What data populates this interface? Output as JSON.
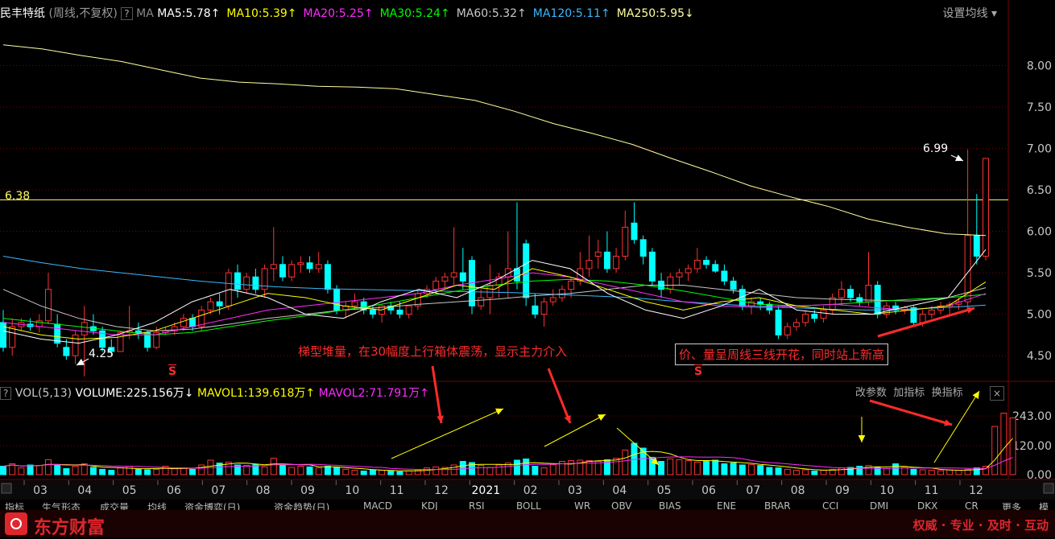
{
  "header": {
    "stock_name": "民丰特纸",
    "period": "(周线,不复权)",
    "help": "?",
    "ma_label": "MA",
    "ma_items": [
      {
        "text": "MA5:5.78",
        "arrow": "↑",
        "color": "#ffffff"
      },
      {
        "text": "MA10:5.39",
        "arrow": "↑",
        "color": "#ffff00"
      },
      {
        "text": "MA20:5.25",
        "arrow": "↑",
        "color": "#ff2bff"
      },
      {
        "text": "MA30:5.24",
        "arrow": "↑",
        "color": "#00ff00"
      },
      {
        "text": "MA60:5.32",
        "arrow": "↑",
        "color": "#c8c8c8"
      },
      {
        "text": "MA120:5.11",
        "arrow": "↑",
        "color": "#3ab8ff"
      },
      {
        "text": "MA250:5.95",
        "arrow": "↓",
        "color": "#ffffa0"
      }
    ],
    "settings": "设置均线"
  },
  "vol_header": {
    "name": "VOL(5,13)",
    "volume": "VOLUME:225.156万",
    "volume_arrow": "↓",
    "mavol1": "MAVOL1:139.618万",
    "mavol1_arrow": "↑",
    "mavol2": "MAVOL2:71.791万",
    "mavol2_arrow": "↑",
    "actions": [
      "改参数",
      "加指标",
      "换指标"
    ],
    "close": "×"
  },
  "annotations": {
    "price_line_label": "6.38",
    "high_label": "6.99",
    "low_label": "4.25",
    "text1": "梯型堆量，在30幅度上行箱体震荡，显示主力介入",
    "text2": "价、量呈周线三线开花，同时站上新高",
    "signal": "S"
  },
  "indicator_tabs": [
    "指标",
    "生气形态",
    "成交量",
    "均线",
    "资金博弈(日)",
    "资金趋势(日)",
    "MACD",
    "KDJ",
    "RSI",
    "BOLL",
    "WR",
    "OBV",
    "BIAS",
    "ENE",
    "BRAR",
    "CCI",
    "DMI",
    "DKX",
    "CR",
    "更多",
    "模板"
  ],
  "footer": {
    "brand": "东方财富",
    "slogan": "权威 · 专业 · 及时 · 互动"
  },
  "colors": {
    "up": "#ff3232",
    "down": "#00ffff",
    "grid": "#7a0000",
    "axis_text": "#c8c8c8"
  },
  "chart_data": {
    "type": "candlestick",
    "price_axis": {
      "ticks": [
        4.5,
        5.0,
        5.5,
        6.0,
        6.5,
        7.0,
        7.5,
        8.0
      ],
      "range": [
        4.2,
        8.5
      ]
    },
    "volume_axis": {
      "ticks": [
        "0.00",
        "120.00",
        "243.00"
      ],
      "range": [
        0,
        300
      ]
    },
    "x_labels": [
      "03",
      "04",
      "05",
      "06",
      "07",
      "08",
      "09",
      "10",
      "11",
      "12",
      "2021",
      "02",
      "03",
      "04",
      "05",
      "06",
      "07",
      "08",
      "09",
      "10",
      "11",
      "12"
    ],
    "horizontal_line": 6.38,
    "candles": [
      {
        "o": 4.9,
        "h": 5.05,
        "l": 4.55,
        "c": 4.6
      },
      {
        "o": 4.6,
        "h": 4.95,
        "l": 4.5,
        "c": 4.85
      },
      {
        "o": 4.85,
        "h": 4.95,
        "l": 4.8,
        "c": 4.9
      },
      {
        "o": 4.88,
        "h": 4.95,
        "l": 4.8,
        "c": 4.85
      },
      {
        "o": 4.85,
        "h": 5.0,
        "l": 4.78,
        "c": 4.92
      },
      {
        "o": 4.92,
        "h": 5.5,
        "l": 4.88,
        "c": 5.3
      },
      {
        "o": 4.88,
        "h": 5.0,
        "l": 4.6,
        "c": 4.65
      },
      {
        "o": 4.6,
        "h": 4.7,
        "l": 4.45,
        "c": 4.5
      },
      {
        "o": 4.5,
        "h": 4.8,
        "l": 4.4,
        "c": 4.75
      },
      {
        "o": 4.75,
        "h": 5.1,
        "l": 4.25,
        "c": 4.9
      },
      {
        "o": 4.85,
        "h": 5.0,
        "l": 4.75,
        "c": 4.8
      },
      {
        "o": 4.8,
        "h": 4.85,
        "l": 4.55,
        "c": 4.6
      },
      {
        "o": 4.6,
        "h": 4.7,
        "l": 4.5,
        "c": 4.55
      },
      {
        "o": 4.55,
        "h": 4.8,
        "l": 4.55,
        "c": 4.78
      },
      {
        "o": 4.78,
        "h": 5.1,
        "l": 4.7,
        "c": 4.8
      },
      {
        "o": 4.8,
        "h": 4.9,
        "l": 4.7,
        "c": 4.78
      },
      {
        "o": 4.78,
        "h": 4.8,
        "l": 4.55,
        "c": 4.6
      },
      {
        "o": 4.6,
        "h": 4.85,
        "l": 4.58,
        "c": 4.78
      },
      {
        "o": 4.78,
        "h": 4.85,
        "l": 4.75,
        "c": 4.8
      },
      {
        "o": 4.8,
        "h": 4.9,
        "l": 4.75,
        "c": 4.85
      },
      {
        "o": 4.85,
        "h": 5.0,
        "l": 4.8,
        "c": 4.95
      },
      {
        "o": 4.95,
        "h": 5.0,
        "l": 4.8,
        "c": 4.85
      },
      {
        "o": 4.85,
        "h": 5.1,
        "l": 4.8,
        "c": 5.05
      },
      {
        "o": 5.05,
        "h": 5.2,
        "l": 5.0,
        "c": 5.15
      },
      {
        "o": 5.15,
        "h": 5.25,
        "l": 5.0,
        "c": 5.1
      },
      {
        "o": 5.1,
        "h": 5.55,
        "l": 5.05,
        "c": 5.5
      },
      {
        "o": 5.5,
        "h": 5.6,
        "l": 5.2,
        "c": 5.3
      },
      {
        "o": 5.3,
        "h": 5.5,
        "l": 5.25,
        "c": 5.45
      },
      {
        "o": 5.45,
        "h": 5.55,
        "l": 5.25,
        "c": 5.3
      },
      {
        "o": 5.3,
        "h": 5.6,
        "l": 5.2,
        "c": 5.55
      },
      {
        "o": 5.55,
        "h": 6.05,
        "l": 5.4,
        "c": 5.6
      },
      {
        "o": 5.6,
        "h": 5.7,
        "l": 5.4,
        "c": 5.45
      },
      {
        "o": 5.45,
        "h": 5.65,
        "l": 5.4,
        "c": 5.6
      },
      {
        "o": 5.6,
        "h": 5.7,
        "l": 5.5,
        "c": 5.62
      },
      {
        "o": 5.62,
        "h": 5.7,
        "l": 5.5,
        "c": 5.55
      },
      {
        "o": 5.55,
        "h": 5.75,
        "l": 5.5,
        "c": 5.6
      },
      {
        "o": 5.6,
        "h": 5.65,
        "l": 5.25,
        "c": 5.3
      },
      {
        "o": 5.3,
        "h": 5.35,
        "l": 5.0,
        "c": 5.05
      },
      {
        "o": 5.05,
        "h": 5.15,
        "l": 4.95,
        "c": 5.1
      },
      {
        "o": 5.1,
        "h": 5.25,
        "l": 5.05,
        "c": 5.15
      },
      {
        "o": 5.15,
        "h": 5.2,
        "l": 5.0,
        "c": 5.05
      },
      {
        "o": 5.05,
        "h": 5.1,
        "l": 4.95,
        "c": 5.0
      },
      {
        "o": 5.0,
        "h": 5.12,
        "l": 4.9,
        "c": 5.1
      },
      {
        "o": 5.1,
        "h": 5.15,
        "l": 5.0,
        "c": 5.05
      },
      {
        "o": 5.05,
        "h": 5.15,
        "l": 4.95,
        "c": 5.0
      },
      {
        "o": 5.0,
        "h": 5.1,
        "l": 4.95,
        "c": 5.1
      },
      {
        "o": 5.1,
        "h": 5.3,
        "l": 5.05,
        "c": 5.25
      },
      {
        "o": 5.25,
        "h": 5.35,
        "l": 5.2,
        "c": 5.3
      },
      {
        "o": 5.3,
        "h": 5.45,
        "l": 5.25,
        "c": 5.4
      },
      {
        "o": 5.4,
        "h": 5.5,
        "l": 5.3,
        "c": 5.45
      },
      {
        "o": 5.45,
        "h": 6.05,
        "l": 5.35,
        "c": 5.5
      },
      {
        "o": 5.5,
        "h": 5.8,
        "l": 5.3,
        "c": 5.4
      },
      {
        "o": 5.65,
        "h": 5.7,
        "l": 5.0,
        "c": 5.1
      },
      {
        "o": 5.1,
        "h": 5.3,
        "l": 5.05,
        "c": 5.2
      },
      {
        "o": 5.2,
        "h": 5.6,
        "l": 5.0,
        "c": 5.35
      },
      {
        "o": 5.35,
        "h": 5.5,
        "l": 5.2,
        "c": 5.45
      },
      {
        "o": 5.45,
        "h": 6.0,
        "l": 5.2,
        "c": 5.55
      },
      {
        "o": 5.55,
        "h": 6.35,
        "l": 5.3,
        "c": 5.4
      },
      {
        "o": 5.85,
        "h": 5.9,
        "l": 5.1,
        "c": 5.2
      },
      {
        "o": 5.1,
        "h": 5.25,
        "l": 4.95,
        "c": 5.0
      },
      {
        "o": 5.0,
        "h": 5.2,
        "l": 4.85,
        "c": 5.15
      },
      {
        "o": 5.15,
        "h": 5.3,
        "l": 5.1,
        "c": 5.2
      },
      {
        "o": 5.2,
        "h": 5.35,
        "l": 5.15,
        "c": 5.3
      },
      {
        "o": 5.3,
        "h": 5.45,
        "l": 5.2,
        "c": 5.4
      },
      {
        "o": 5.4,
        "h": 5.75,
        "l": 5.35,
        "c": 5.55
      },
      {
        "o": 5.55,
        "h": 5.95,
        "l": 5.45,
        "c": 5.65
      },
      {
        "o": 5.7,
        "h": 5.9,
        "l": 5.55,
        "c": 5.75
      },
      {
        "o": 5.75,
        "h": 6.0,
        "l": 5.5,
        "c": 5.55
      },
      {
        "o": 5.55,
        "h": 5.8,
        "l": 5.5,
        "c": 5.7
      },
      {
        "o": 5.7,
        "h": 6.25,
        "l": 5.65,
        "c": 6.05
      },
      {
        "o": 6.1,
        "h": 6.35,
        "l": 5.85,
        "c": 5.9
      },
      {
        "o": 5.9,
        "h": 5.95,
        "l": 5.6,
        "c": 5.7
      },
      {
        "o": 5.75,
        "h": 5.8,
        "l": 5.35,
        "c": 5.4
      },
      {
        "o": 5.4,
        "h": 5.5,
        "l": 5.2,
        "c": 5.3
      },
      {
        "o": 5.3,
        "h": 5.5,
        "l": 5.25,
        "c": 5.45
      },
      {
        "o": 5.45,
        "h": 5.55,
        "l": 5.35,
        "c": 5.5
      },
      {
        "o": 5.5,
        "h": 5.6,
        "l": 5.4,
        "c": 5.55
      },
      {
        "o": 5.55,
        "h": 5.8,
        "l": 5.5,
        "c": 5.65
      },
      {
        "o": 5.65,
        "h": 5.7,
        "l": 5.55,
        "c": 5.6
      },
      {
        "o": 5.6,
        "h": 5.65,
        "l": 5.5,
        "c": 5.52
      },
      {
        "o": 5.52,
        "h": 5.6,
        "l": 5.35,
        "c": 5.4
      },
      {
        "o": 5.4,
        "h": 5.45,
        "l": 5.25,
        "c": 5.3
      },
      {
        "o": 5.3,
        "h": 5.35,
        "l": 5.05,
        "c": 5.1
      },
      {
        "o": 5.1,
        "h": 5.2,
        "l": 5.0,
        "c": 5.15
      },
      {
        "o": 5.15,
        "h": 5.2,
        "l": 5.05,
        "c": 5.12
      },
      {
        "o": 5.12,
        "h": 5.15,
        "l": 5.0,
        "c": 5.05
      },
      {
        "o": 5.05,
        "h": 5.1,
        "l": 4.7,
        "c": 4.75
      },
      {
        "o": 4.75,
        "h": 4.9,
        "l": 4.7,
        "c": 4.85
      },
      {
        "o": 4.85,
        "h": 4.95,
        "l": 4.8,
        "c": 4.9
      },
      {
        "o": 4.9,
        "h": 5.05,
        "l": 4.85,
        "c": 5.0
      },
      {
        "o": 5.0,
        "h": 5.05,
        "l": 4.9,
        "c": 4.95
      },
      {
        "o": 4.95,
        "h": 5.1,
        "l": 4.9,
        "c": 5.05
      },
      {
        "o": 5.05,
        "h": 5.25,
        "l": 5.0,
        "c": 5.2
      },
      {
        "o": 5.2,
        "h": 5.4,
        "l": 5.1,
        "c": 5.3
      },
      {
        "o": 5.3,
        "h": 5.35,
        "l": 5.15,
        "c": 5.2
      },
      {
        "o": 5.2,
        "h": 5.25,
        "l": 5.1,
        "c": 5.15
      },
      {
        "o": 5.15,
        "h": 5.75,
        "l": 5.1,
        "c": 5.35
      },
      {
        "o": 5.35,
        "h": 5.4,
        "l": 4.95,
        "c": 5.0
      },
      {
        "o": 5.0,
        "h": 5.15,
        "l": 4.95,
        "c": 5.1
      },
      {
        "o": 5.1,
        "h": 5.15,
        "l": 5.0,
        "c": 5.05
      },
      {
        "o": 5.05,
        "h": 5.1,
        "l": 5.0,
        "c": 5.08
      },
      {
        "o": 5.08,
        "h": 5.1,
        "l": 4.85,
        "c": 4.9
      },
      {
        "o": 4.9,
        "h": 5.05,
        "l": 4.85,
        "c": 5.0
      },
      {
        "o": 5.0,
        "h": 5.1,
        "l": 4.95,
        "c": 5.05
      },
      {
        "o": 5.05,
        "h": 5.15,
        "l": 5.0,
        "c": 5.1
      },
      {
        "o": 5.1,
        "h": 5.15,
        "l": 5.0,
        "c": 5.12
      },
      {
        "o": 5.12,
        "h": 5.2,
        "l": 5.05,
        "c": 5.15
      },
      {
        "o": 5.15,
        "h": 6.99,
        "l": 5.1,
        "c": 5.95
      },
      {
        "o": 5.95,
        "h": 6.45,
        "l": 5.6,
        "c": 5.7
      },
      {
        "o": 5.7,
        "h": 6.88,
        "l": 5.65,
        "c": 6.88
      }
    ],
    "volumes": [
      35,
      45,
      28,
      40,
      38,
      62,
      42,
      25,
      35,
      45,
      30,
      22,
      18,
      28,
      35,
      22,
      20,
      22,
      35,
      25,
      28,
      22,
      40,
      60,
      48,
      52,
      40,
      38,
      42,
      32,
      68,
      40,
      30,
      35,
      32,
      28,
      35,
      30,
      22,
      18,
      15,
      20,
      18,
      15,
      12,
      15,
      20,
      28,
      32,
      30,
      40,
      55,
      50,
      38,
      30,
      40,
      48,
      60,
      65,
      35,
      28,
      42,
      55,
      58,
      60,
      58,
      55,
      62,
      68,
      102,
      130,
      110,
      72,
      55,
      65,
      62,
      58,
      52,
      55,
      60,
      45,
      48,
      40,
      42,
      38,
      30,
      28,
      22,
      18,
      20,
      15,
      18,
      22,
      28,
      30,
      35,
      38,
      30,
      25,
      45,
      32,
      22,
      20,
      18,
      16,
      20,
      18,
      22,
      28,
      35,
      200,
      255,
      235
    ],
    "series": [
      {
        "name": "MA250",
        "color": "#ffffa0",
        "values": [
          8.25,
          8.2,
          8.12,
          8.05,
          7.95,
          7.85,
          7.8,
          7.78,
          7.75,
          7.74,
          7.72,
          7.65,
          7.58,
          7.45,
          7.3,
          7.18,
          7.05,
          6.88,
          6.72,
          6.55,
          6.42,
          6.3,
          6.15,
          6.05,
          5.97,
          5.95
        ]
      },
      {
        "name": "MA120",
        "color": "#3ab8ff",
        "values": [
          5.7,
          5.62,
          5.55,
          5.5,
          5.45,
          5.4,
          5.36,
          5.33,
          5.31,
          5.3,
          5.29,
          5.28,
          5.27,
          5.26,
          5.24,
          5.22,
          5.2,
          5.16,
          5.13,
          5.1,
          5.08,
          5.06,
          5.05,
          5.06,
          5.08,
          5.11
        ]
      },
      {
        "name": "MA60",
        "color": "#c8c8c8",
        "values": [
          5.3,
          5.1,
          4.95,
          4.85,
          4.8,
          4.82,
          4.88,
          4.95,
          5.0,
          5.05,
          5.08,
          5.12,
          5.15,
          5.18,
          5.22,
          5.25,
          5.3,
          5.35,
          5.35,
          5.3,
          5.25,
          5.2,
          5.18,
          5.17,
          5.16,
          5.2,
          5.32
        ]
      },
      {
        "name": "MA30",
        "color": "#00ff00",
        "values": [
          4.95,
          4.9,
          4.85,
          4.8,
          4.75,
          4.78,
          4.85,
          4.92,
          4.98,
          5.05,
          5.12,
          5.2,
          5.28,
          5.35,
          5.4,
          5.42,
          5.4,
          5.35,
          5.28,
          5.2,
          5.12,
          5.1,
          5.12,
          5.15,
          5.18,
          5.2,
          5.24
        ]
      },
      {
        "name": "MA20",
        "color": "#ff2bff",
        "values": [
          4.9,
          4.85,
          4.8,
          4.75,
          4.75,
          4.85,
          4.95,
          5.05,
          5.1,
          5.15,
          5.2,
          5.25,
          5.35,
          5.42,
          5.5,
          5.45,
          5.35,
          5.25,
          5.15,
          5.1,
          5.08,
          5.1,
          5.12,
          5.08,
          5.05,
          5.1,
          5.25
        ]
      },
      {
        "name": "MA10",
        "color": "#ffff00",
        "values": [
          4.85,
          4.75,
          4.7,
          4.72,
          4.8,
          4.95,
          5.1,
          5.25,
          5.2,
          5.1,
          5.05,
          5.2,
          5.35,
          5.3,
          5.55,
          5.45,
          5.3,
          5.15,
          5.05,
          5.15,
          5.2,
          5.1,
          5.05,
          5.0,
          5.05,
          5.1,
          5.39
        ]
      },
      {
        "name": "MA5",
        "color": "#ffffff",
        "values": [
          4.8,
          4.7,
          4.65,
          4.75,
          4.9,
          5.15,
          5.3,
          5.2,
          5.0,
          4.95,
          5.15,
          5.3,
          5.2,
          5.4,
          5.65,
          5.55,
          5.25,
          5.05,
          4.95,
          5.1,
          5.3,
          5.05,
          5.0,
          5.0,
          5.1,
          5.2,
          5.78
        ]
      }
    ]
  }
}
